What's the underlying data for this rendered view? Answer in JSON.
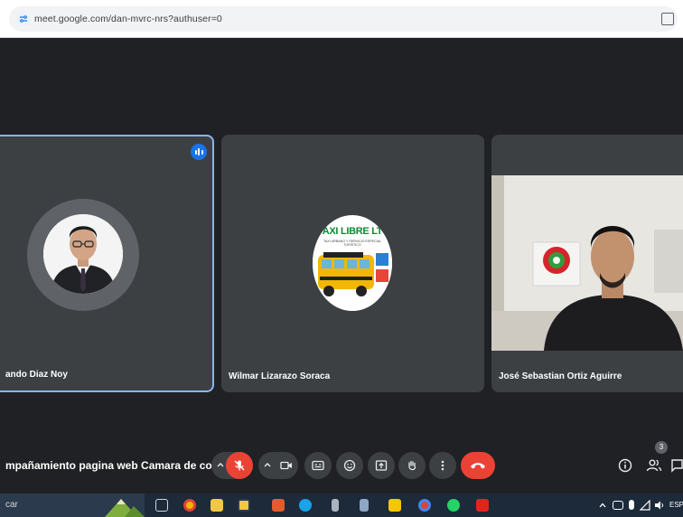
{
  "browser": {
    "url": "meet.google.com/dan-mvrc-nrs?authuser=0"
  },
  "participants": [
    {
      "name": "ando Diaz Noy",
      "speaking": true
    },
    {
      "name": "Wilmar Lizarazo Soraca",
      "logo_title": "AXI LIBRE LT",
      "logo_subtitle": "TAXI URBANO Y SERVICIO ESPECIAL TURISTICO"
    },
    {
      "name": "José Sebastian Ortiz Aguirre"
    }
  ],
  "controls": {
    "meeting_title": "mpañamiento pagina web Camara de co...",
    "people_count": "3",
    "mic_muted": true
  },
  "taskbar": {
    "search_text": "car",
    "language": "ESP"
  },
  "colors": {
    "meet_background": "#202124",
    "tile_background": "#3c4043",
    "active_speaker_border": "#8ab4f8",
    "danger_red": "#ea4335",
    "speaking_blue": "#1a73e8"
  }
}
